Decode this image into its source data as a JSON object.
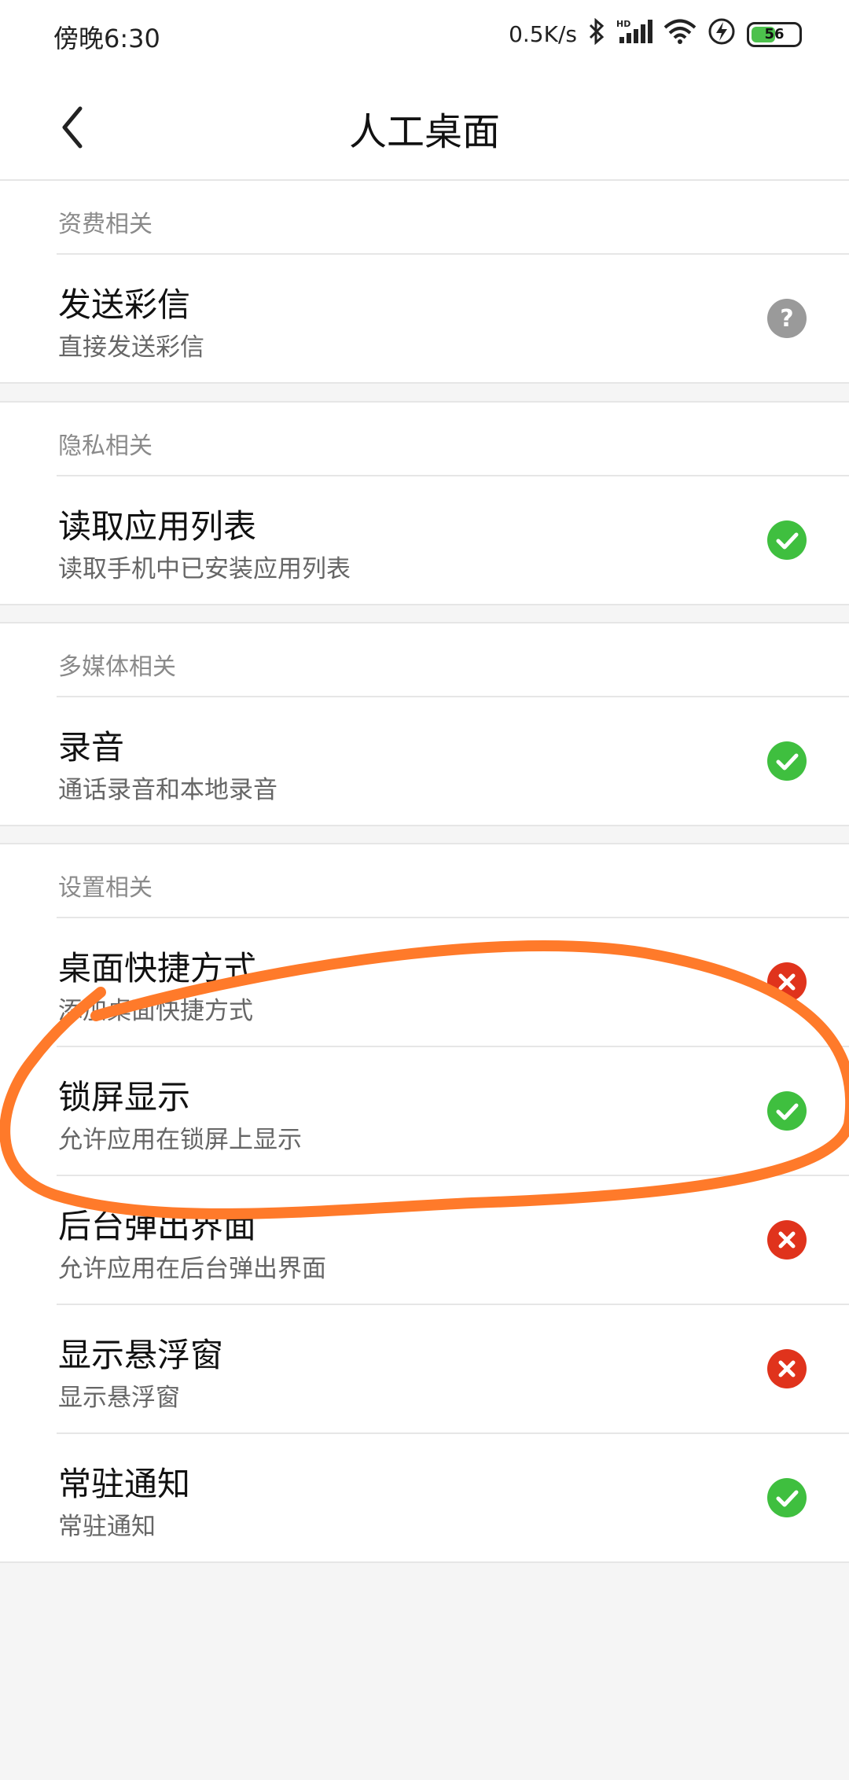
{
  "status_bar": {
    "time": "傍晚6:30",
    "network_speed": "0.5K/s",
    "battery": "56",
    "battery_level": 0.56,
    "icons": [
      "bluetooth-icon",
      "hd-signal-icon",
      "wifi-icon",
      "charging-icon",
      "battery-icon"
    ]
  },
  "header": {
    "title": "人工桌面",
    "back_icon": "chevron-left-icon"
  },
  "sections": [
    {
      "label": "资费相关",
      "items": [
        {
          "title": "发送彩信",
          "subtitle": "直接发送彩信",
          "status": "ask"
        }
      ]
    },
    {
      "label": "隐私相关",
      "items": [
        {
          "title": "读取应用列表",
          "subtitle": "读取手机中已安装应用列表",
          "status": "allowed"
        }
      ]
    },
    {
      "label": "多媒体相关",
      "items": [
        {
          "title": "录音",
          "subtitle": "通话录音和本地录音",
          "status": "allowed"
        }
      ]
    },
    {
      "label": "设置相关",
      "items": [
        {
          "title": "桌面快捷方式",
          "subtitle": "添加桌面快捷方式",
          "status": "denied"
        },
        {
          "title": "锁屏显示",
          "subtitle": "允许应用在锁屏上显示",
          "status": "allowed"
        },
        {
          "title": "后台弹出界面",
          "subtitle": "允许应用在后台弹出界面",
          "status": "denied"
        },
        {
          "title": "显示悬浮窗",
          "subtitle": "显示悬浮窗",
          "status": "denied"
        },
        {
          "title": "常驻通知",
          "subtitle": "常驻通知",
          "status": "allowed"
        }
      ]
    }
  ],
  "colors": {
    "allowed": "#3fbf3f",
    "denied": "#e0331c",
    "ask": "#9a9a9a",
    "annotation": "#ff7a2a"
  }
}
